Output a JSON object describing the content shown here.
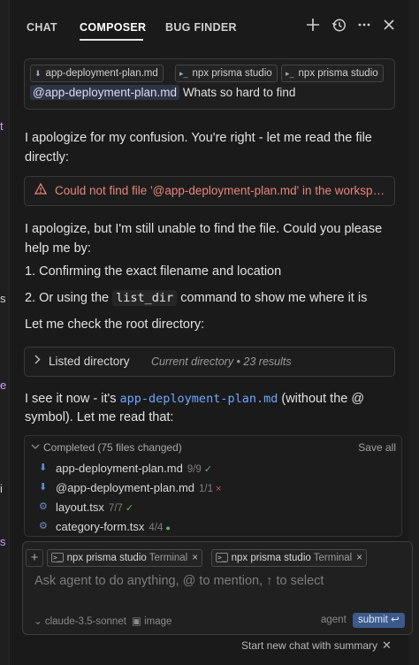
{
  "header": {
    "tabs": [
      {
        "label": "CHAT"
      },
      {
        "label": "COMPOSER"
      },
      {
        "label": "BUG FINDER"
      }
    ],
    "icons": [
      "plus-icon",
      "history-icon",
      "more-icon",
      "close-icon"
    ]
  },
  "context": {
    "chips": [
      {
        "label": "app-deployment-plan.md"
      },
      {
        "label": "npx prisma studio"
      },
      {
        "label": "npx prisma studio"
      }
    ],
    "mention": "@app-deployment-plan.md",
    "message": "Whats so hard to find"
  },
  "messages": {
    "m1": "I apologize for my confusion. You're right - let me read the file directly:",
    "error": "Could not find file '@app-deployment-plan.md' in the workspace",
    "m2": "I apologize, but I'm still unable to find the file. Could you please help me by:",
    "item1": "1. Confirming the exact filename and location",
    "item2_pre": "2. Or using the",
    "item2_code": "list_dir",
    "item2_post": "command to show me where it is",
    "m3": "Let me check the root directory:",
    "listed_label": "Listed directory",
    "listed_sub": "Current directory • 23 results",
    "m4_pre": "I see it now - it's",
    "m4_link": "app-deployment-plan.md",
    "m4_post": "(without the @",
    "m4_line2": "symbol). Let me read that:"
  },
  "completed": {
    "title": "Completed",
    "count": "(75 files changed)",
    "save_all": "Save all",
    "files": [
      {
        "name": "app-deployment-plan.md",
        "count": "9/9",
        "status": "✓"
      },
      {
        "name": "@app-deployment-plan.md",
        "count": "1/1",
        "status": "×"
      },
      {
        "name": "layout.tsx",
        "count": "7/7",
        "status": "✓"
      },
      {
        "name": "category-form.tsx",
        "count": "4/4",
        "status": "●"
      }
    ]
  },
  "composer": {
    "terminals": [
      {
        "label": "npx prisma studio",
        "type": "Terminal"
      },
      {
        "label": "npx prisma studio",
        "type": "Terminal"
      }
    ],
    "placeholder": "Ask agent to do anything, @ to mention, ↑ to select",
    "model": "claude-3.5-sonnet",
    "image_label": "image",
    "mode": "agent",
    "submit": "submit ↩"
  },
  "footer": {
    "label": "Start new chat with summary"
  },
  "colors": {
    "background": "#1a1a1a",
    "error": "#e8857a",
    "link": "#6ea7ff",
    "success": "#5fb86a",
    "submit": "#3b5a8a"
  }
}
